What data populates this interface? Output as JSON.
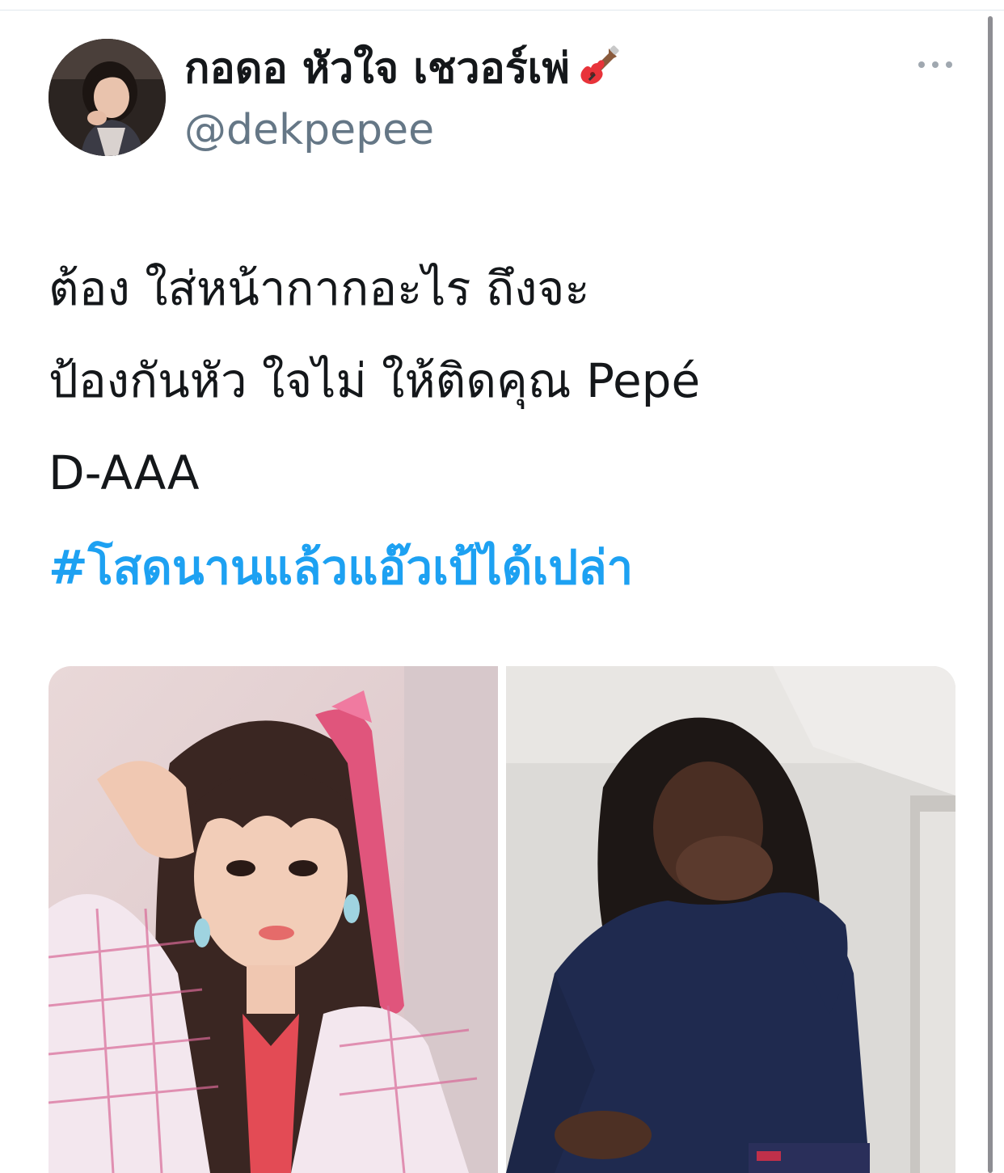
{
  "tweet": {
    "author": {
      "display_name": "กอดอ หัวใจ เชวอร์เพ่",
      "name_emoji": "guitar-emoji",
      "handle": "@dekpepee",
      "avatar": "profile-photo"
    },
    "more_icon": "ellipsis-icon",
    "text_lines": [
      "ต้อง ใส่หน้ากากอะไร ถึงจะ",
      "ป้องกันหัว ใจไม่ ให้ติดคุณ Pepé",
      "D-AAA"
    ],
    "hashtag": "#โสดนานแล้วแอ๊วเป้ได้เปล่า",
    "media": [
      {
        "kind": "photo",
        "description_icon": "photo-woman-pink-ribbon"
      },
      {
        "kind": "photo",
        "description_icon": "photo-woman-covering-mouth"
      }
    ]
  },
  "colors": {
    "text": "#14171a",
    "secondary_text": "#657786",
    "link": "#1da1f2",
    "divider": "#e1e8ed"
  }
}
